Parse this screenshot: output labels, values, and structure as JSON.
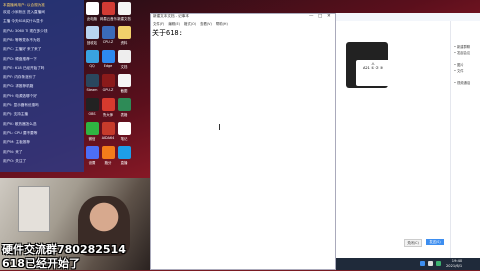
{
  "overlay": {
    "group_line": "硬件交流群780282514",
    "status_line": "618已经开始了"
  },
  "notepad": {
    "title": "新建文本文档 - 记事本",
    "menu": [
      "文件(F)",
      "编辑(E)",
      "格式(O)",
      "查看(V)",
      "帮助(H)"
    ],
    "content": "关于618:",
    "window_buttons": [
      "—",
      "□",
      "✕"
    ]
  },
  "chat_overlay": {
    "header": "本直播间用户: 以合规为准",
    "lines": [
      "欢迎 小米粉丝 进入直播间",
      "主播 今天618买什么显卡",
      "用户A: 3060 Ti 现在多少钱",
      "用户B: 等等党永不为奴",
      "用户C: 主播好 来了来了",
      "用户D: 硬盘推荐一下",
      "用户E: 618 已经开始了吗",
      "用户F: 内存条涨价了",
      "用户G: 求推荐机箱",
      "用户H: 电源选哪个好",
      "用户I: 显示器有优惠吗",
      "用户J: 支持主播",
      "用户K: 散热器怎么选",
      "用户L: CPU 要不要等",
      "用户M: 主板推荐",
      "用户N: 来了",
      "用户O: 关注了"
    ]
  },
  "desktop_icons": [
    {
      "label": "此电脑",
      "color": "#ffffff"
    },
    {
      "label": "网易云音乐",
      "color": "#d23b34"
    },
    {
      "label": "新建文档",
      "color": "#f4f4f4"
    },
    {
      "label": "回收站",
      "color": "#b8d4f0"
    },
    {
      "label": "CPU-Z",
      "color": "#3a6ab8"
    },
    {
      "label": "资料",
      "color": "#f2d16b"
    },
    {
      "label": "QQ",
      "color": "#39a2e0"
    },
    {
      "label": "Edge",
      "color": "#2d89ef"
    },
    {
      "label": "文档",
      "color": "#eeeeee"
    },
    {
      "label": "Steam",
      "color": "#2a475e"
    },
    {
      "label": "GPU-Z",
      "color": "#8a1a1a"
    },
    {
      "label": "截图",
      "color": "#f5f5f5"
    },
    {
      "label": "OBS",
      "color": "#222222"
    },
    {
      "label": "鲁大师",
      "color": "#d73a2e"
    },
    {
      "label": "表格",
      "color": "#2e8b57"
    },
    {
      "label": "微信",
      "color": "#2fb542"
    },
    {
      "label": "AIDA64",
      "color": "#c63b2b"
    },
    {
      "label": "笔记",
      "color": "#ffffff"
    },
    {
      "label": "设置",
      "color": "#4c6ef5"
    },
    {
      "label": "跑分",
      "color": "#f27c1a"
    },
    {
      "label": "直播",
      "color": "#1e9ee8"
    }
  ],
  "app": {
    "photo_label": "A21 ① ② ③",
    "side_items": [
      "• 新建群聊",
      "• 发起会议",
      "",
      "• 图片",
      "• 文件",
      "",
      "• 视频通话"
    ],
    "close_button": "关闭(C)",
    "send_button": "发送(S)"
  },
  "clock": {
    "time": "19:40",
    "date": "2021/6/1"
  },
  "colors": {
    "chat_bg": "#283c8c",
    "send": "#3d8ef0",
    "taskbar": "#1f2a3a"
  }
}
